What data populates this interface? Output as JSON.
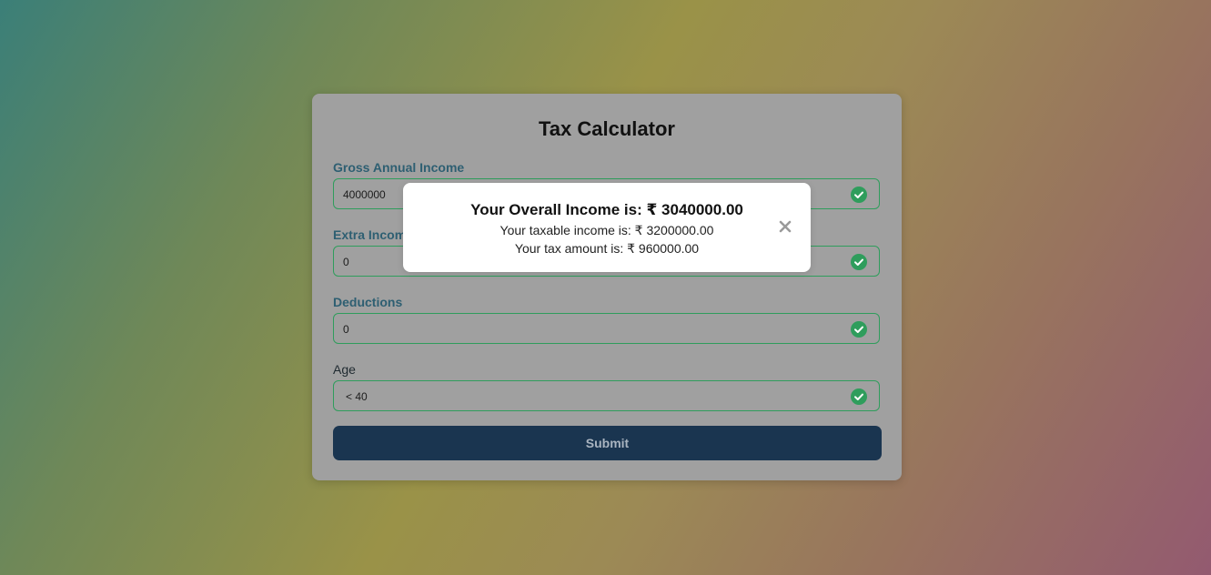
{
  "form": {
    "title": "Tax Calculator",
    "fields": [
      {
        "label": "Gross Annual Income",
        "value": "4000000",
        "icon": "check-circle-icon"
      },
      {
        "label": "Extra Income",
        "value": "0",
        "icon": "check-circle-icon"
      },
      {
        "label": "Deductions",
        "value": "0",
        "icon": "check-circle-icon"
      },
      {
        "label": "Age",
        "value": "< 40",
        "icon": "check-circle-icon"
      }
    ],
    "submit_label": "Submit"
  },
  "modal": {
    "overall_income": "Your Overall Income is: ₹ 3040000.00",
    "taxable_income": "Your taxable income is: ₹ 3200000.00",
    "tax_amount": "Your tax amount is: ₹ 960000.00",
    "close_icon": "close-icon"
  },
  "colors": {
    "card": "#a0a0a0",
    "field_border": "#2f9d5c",
    "check": "#2f9d5c",
    "label": "#2e5f72",
    "button": "#1a3550"
  }
}
